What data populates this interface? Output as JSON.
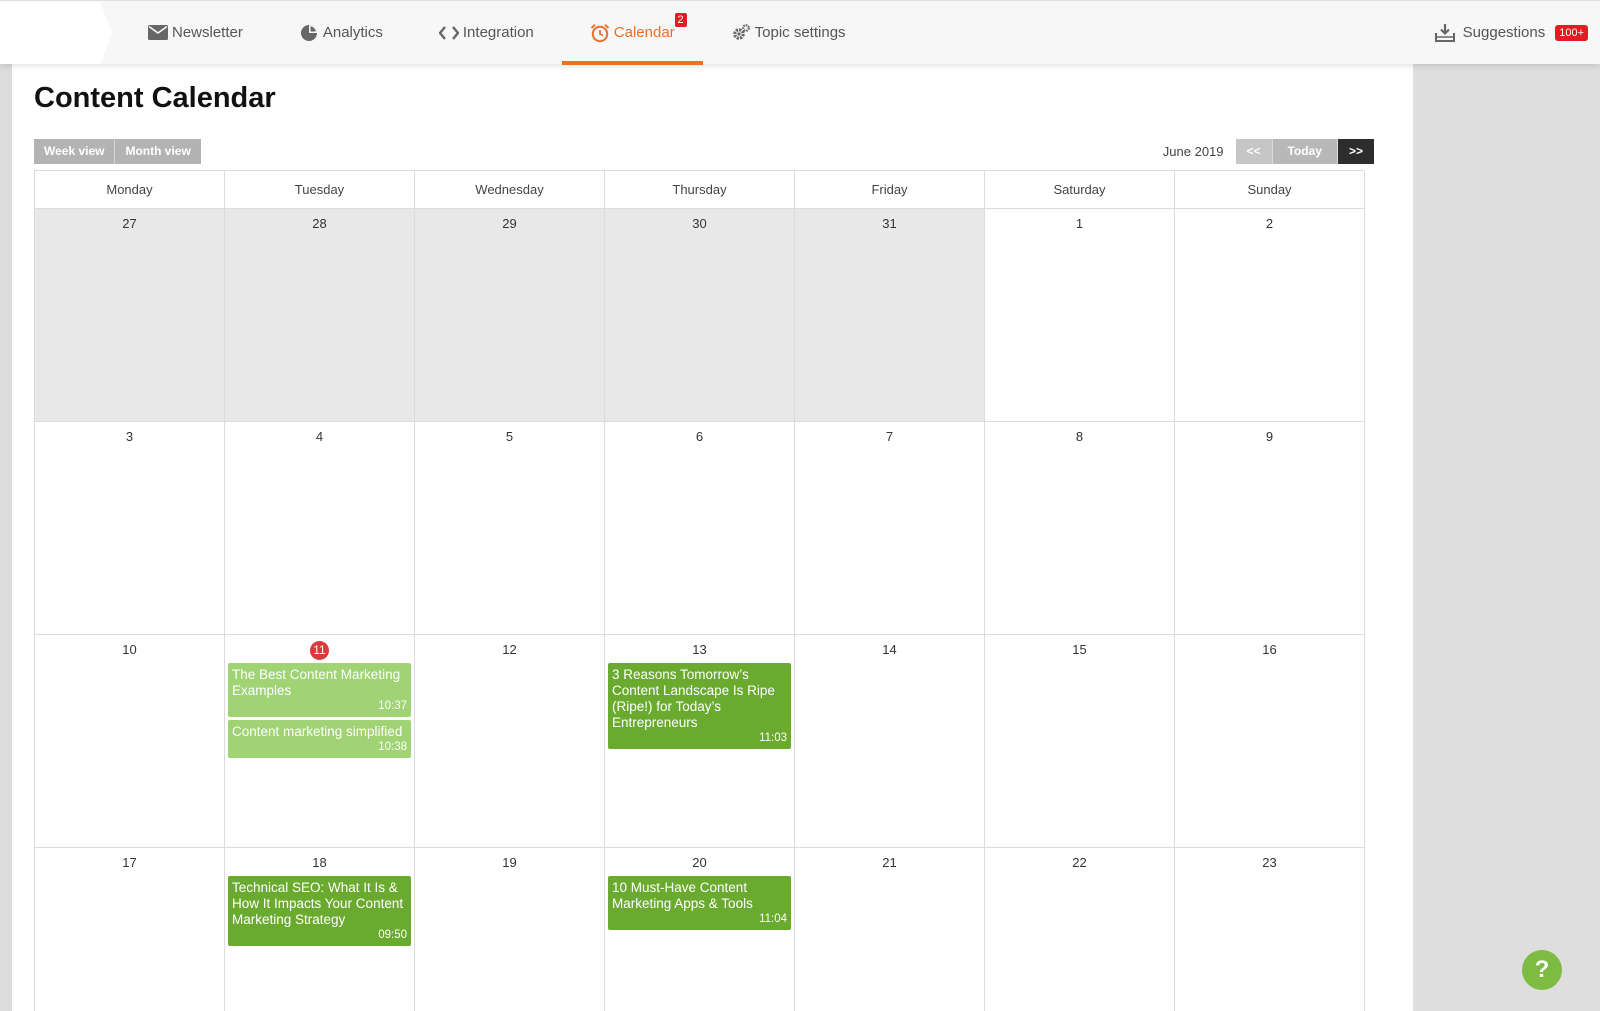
{
  "nav": {
    "items": [
      {
        "label": "Newsletter",
        "icon": "envelope-icon"
      },
      {
        "label": "Analytics",
        "icon": "pie-chart-icon"
      },
      {
        "label": "Integration",
        "icon": "code-icon"
      },
      {
        "label": "Calendar",
        "icon": "alarm-clock-icon",
        "active": true,
        "badge": "2"
      },
      {
        "label": "Topic settings",
        "icon": "gears-icon"
      }
    ],
    "suggestions": {
      "label": "Suggestions",
      "badge": "100+",
      "icon": "inbox-download-icon"
    }
  },
  "page": {
    "title": "Content Calendar"
  },
  "views": {
    "week": "Week view",
    "month": "Month view"
  },
  "month_nav": {
    "label": "June 2019",
    "prev": "<<",
    "today": "Today",
    "next": ">>"
  },
  "weekdays": [
    "Monday",
    "Tuesday",
    "Wednesday",
    "Thursday",
    "Friday",
    "Saturday",
    "Sunday"
  ],
  "weeks": [
    [
      {
        "day": "27",
        "other_month": true,
        "events": []
      },
      {
        "day": "28",
        "other_month": true,
        "events": []
      },
      {
        "day": "29",
        "other_month": true,
        "events": []
      },
      {
        "day": "30",
        "other_month": true,
        "events": []
      },
      {
        "day": "31",
        "other_month": true,
        "events": []
      },
      {
        "day": "1",
        "events": []
      },
      {
        "day": "2",
        "events": []
      }
    ],
    [
      {
        "day": "3",
        "events": []
      },
      {
        "day": "4",
        "events": []
      },
      {
        "day": "5",
        "events": []
      },
      {
        "day": "6",
        "events": []
      },
      {
        "day": "7",
        "events": []
      },
      {
        "day": "8",
        "events": []
      },
      {
        "day": "9",
        "events": []
      }
    ],
    [
      {
        "day": "10",
        "events": []
      },
      {
        "day": "11",
        "today": true,
        "events": [
          {
            "title": "The Best Content Marketing Examples",
            "time": "10:37",
            "style": "light"
          },
          {
            "title": "Content marketing simplified",
            "time": "10:38",
            "style": "light"
          }
        ]
      },
      {
        "day": "12",
        "events": []
      },
      {
        "day": "13",
        "events": [
          {
            "title": "3 Reasons Tomorrow’s Content Landscape Is Ripe (Ripe!) for Today’s Entrepreneurs",
            "time": "11:03",
            "style": "dark"
          }
        ]
      },
      {
        "day": "14",
        "events": []
      },
      {
        "day": "15",
        "events": []
      },
      {
        "day": "16",
        "events": []
      }
    ],
    [
      {
        "day": "17",
        "events": []
      },
      {
        "day": "18",
        "events": [
          {
            "title": "Technical SEO: What It Is & How It Impacts Your Content Marketing Strategy",
            "time": "09:50",
            "style": "dark"
          }
        ]
      },
      {
        "day": "19",
        "events": []
      },
      {
        "day": "20",
        "events": [
          {
            "title": "10 Must-Have Content Marketing Apps & Tools",
            "time": "11:04",
            "style": "dark"
          }
        ]
      },
      {
        "day": "21",
        "events": []
      },
      {
        "day": "22",
        "events": []
      },
      {
        "day": "23",
        "events": []
      }
    ]
  ],
  "help": {
    "label": "?"
  },
  "colors": {
    "accent": "#e8702a",
    "badge": "#e31b23",
    "event_light": "#9fd373",
    "event_dark": "#6aab2f",
    "today_circle": "#d93b3b"
  }
}
